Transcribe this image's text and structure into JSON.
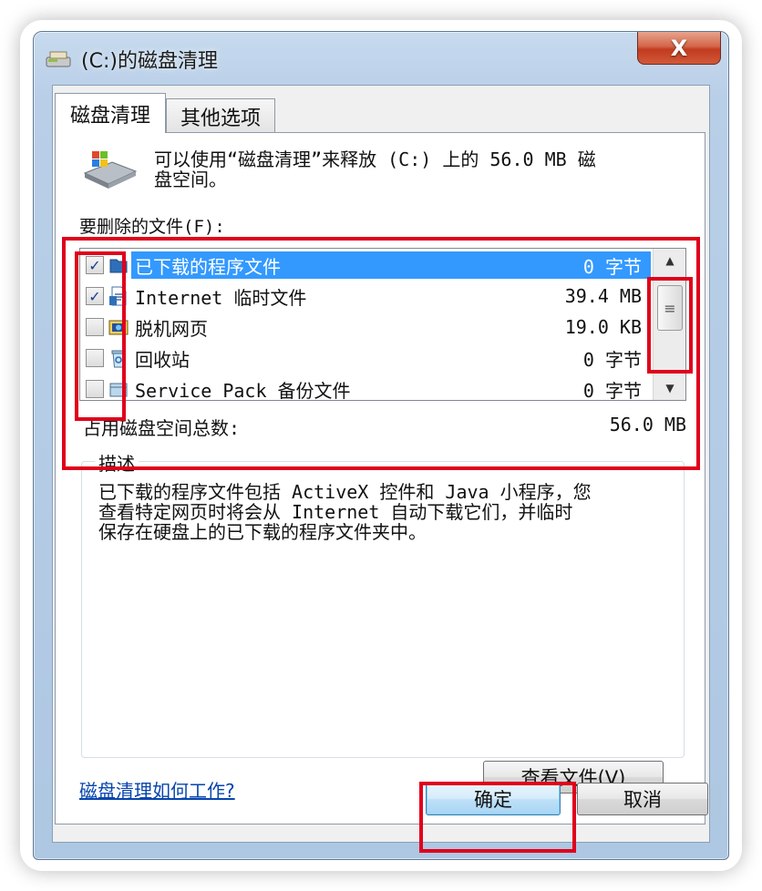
{
  "window": {
    "title": "(C:)的磁盘清理",
    "close_label": "X"
  },
  "tabs": [
    {
      "label": "磁盘清理",
      "active": true
    },
    {
      "label": "其他选项",
      "active": false
    }
  ],
  "intro": {
    "text_line1": "可以使用“磁盘清理”来释放  (C:) 上的 56.0 MB 磁",
    "text_line2": "盘空间。"
  },
  "files_label": "要删除的文件(F):",
  "file_list": [
    {
      "label": "已下载的程序文件",
      "size": "0 字节",
      "checked": true,
      "selected": true,
      "icon": "folder-icon"
    },
    {
      "label": "Internet 临时文件",
      "size": "39.4 MB",
      "checked": true,
      "selected": false,
      "icon": "document-icon"
    },
    {
      "label": "脱机网页",
      "size": "19.0 KB",
      "checked": false,
      "selected": false,
      "icon": "web-page-icon"
    },
    {
      "label": "回收站",
      "size": "0 字节",
      "checked": false,
      "selected": false,
      "icon": "recycle-bin-icon"
    },
    {
      "label": "Service Pack 备份文件",
      "size": "0 字节",
      "checked": false,
      "selected": false,
      "icon": "backup-icon"
    }
  ],
  "total": {
    "label": "占用磁盘空间总数:",
    "value": "56.0 MB"
  },
  "description": {
    "legend": "描述",
    "line1": "已下载的程序文件包括 ActiveX 控件和 Java 小程序，您",
    "line2": "查看特定网页时将会从 Internet 自动下载它们，并临时",
    "line3": "保存在硬盘上的已下载的程序文件夹中。",
    "view_files_label": "查看文件(V)"
  },
  "help_link": "磁盘清理如何工作?",
  "buttons": {
    "ok": "确定",
    "cancel": "取消"
  },
  "colors": {
    "highlight": "#e0001b",
    "selection": "#3399ff",
    "link": "#0645ad"
  }
}
